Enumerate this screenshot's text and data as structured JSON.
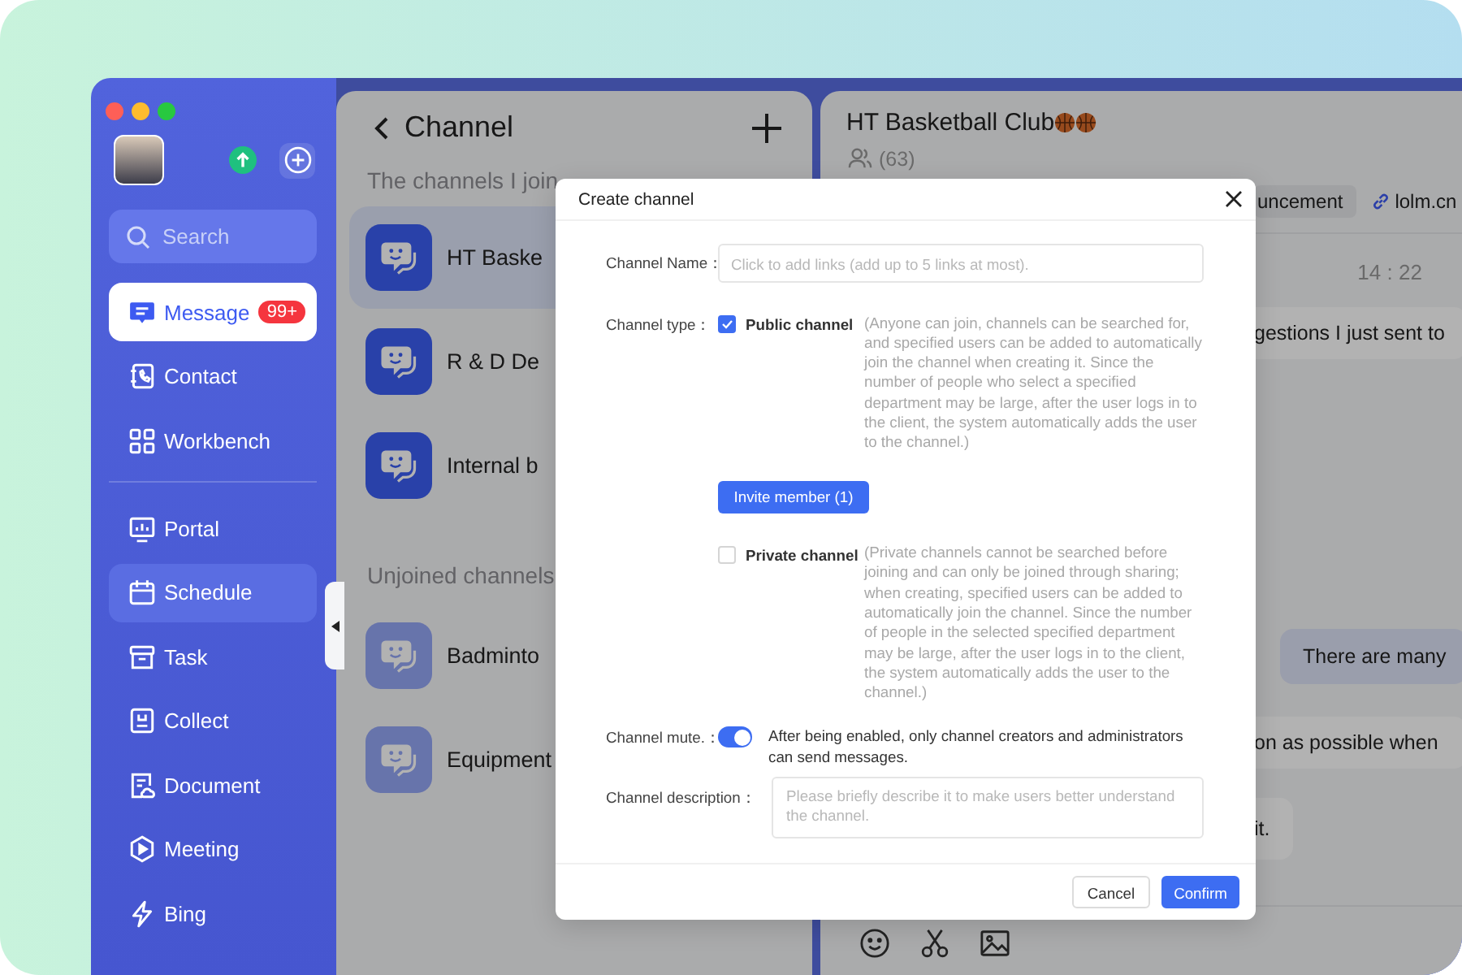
{
  "sidebar": {
    "search": {
      "placeholder": "Search"
    },
    "groups": [
      {
        "items": [
          {
            "kind": "message",
            "label": "Message",
            "selected": true,
            "hovered": false,
            "badge": "99+"
          },
          {
            "kind": "contact",
            "label": "Contact",
            "selected": false,
            "hovered": false
          },
          {
            "kind": "workbench",
            "label": "Workbench",
            "selected": false,
            "hovered": false
          }
        ]
      },
      {
        "items": [
          {
            "kind": "portal",
            "label": "Portal",
            "selected": false,
            "hovered": false
          },
          {
            "kind": "schedule",
            "label": "Schedule",
            "selected": false,
            "hovered": true
          },
          {
            "kind": "task",
            "label": "Task",
            "selected": false,
            "hovered": false
          },
          {
            "kind": "collect",
            "label": "Collect",
            "selected": false,
            "hovered": false
          },
          {
            "kind": "document",
            "label": "Document",
            "selected": false,
            "hovered": false
          },
          {
            "kind": "meeting",
            "label": "Meeting",
            "selected": false,
            "hovered": false
          },
          {
            "kind": "bing",
            "label": "Bing",
            "selected": false,
            "hovered": false
          }
        ]
      }
    ]
  },
  "channel_list": {
    "title": "Channel",
    "sections": [
      {
        "heading": "The channels I join",
        "joined": true,
        "channels": [
          {
            "name": "HT Baske",
            "selected": true
          },
          {
            "name": "R & D De",
            "selected": false
          },
          {
            "name": "Internal b",
            "selected": false
          }
        ]
      },
      {
        "heading": "Unjoined channels",
        "joined": false,
        "channels": [
          {
            "name": "Badminto",
            "selected": false
          },
          {
            "name": "Equipment",
            "selected": false
          }
        ]
      }
    ]
  },
  "chat": {
    "title": "HT Basketball Club",
    "member_count": "(63)",
    "tabs": [
      {
        "kind": "pill",
        "label": "uncement"
      },
      {
        "kind": "link",
        "label": "lolm.cn"
      }
    ],
    "time": "14 : 22",
    "messages": [
      {
        "outgoing": false,
        "text": "gestions I just sent to"
      },
      {
        "outgoing": true,
        "text": "There are many"
      },
      {
        "outgoing": false,
        "text": "on as possible when"
      },
      {
        "outgoing": false,
        "text": "it."
      }
    ]
  },
  "dialog": {
    "title": "Create channel",
    "name_field": {
      "label": "Channel Name：",
      "placeholder": "Click to add links (add up to 5 links at most)."
    },
    "type": {
      "label": "Channel type：",
      "options": [
        {
          "label": "Public channel",
          "checked": true,
          "description": "(Anyone can join, channels can be searched for, and specified users can be added to automatically join the channel when creating it. Since the number of people who select a specified department may be large, after the user logs in to the client, the system automatically adds the user to the channel.)",
          "button": "Invite member (1)"
        },
        {
          "label": "Private channel",
          "checked": false,
          "description": "(Private channels cannot be searched before joining and can only be joined through sharing; when creating, specified users can be added to automatically join the channel. Since the number of people in the selected specified department may be large, after the user logs in to the client, the system automatically adds the user to the channel.)"
        }
      ]
    },
    "mute": {
      "label": "Channel mute.：",
      "on": true,
      "note": "After being enabled, only channel creators and administrators can send messages."
    },
    "description_field": {
      "label": "Channel description：",
      "placeholder": "Please briefly describe it to make users better understand the channel."
    },
    "buttons": [
      {
        "kind": "secondary",
        "label": "Cancel"
      },
      {
        "kind": "primary",
        "label": "Confirm"
      }
    ]
  }
}
